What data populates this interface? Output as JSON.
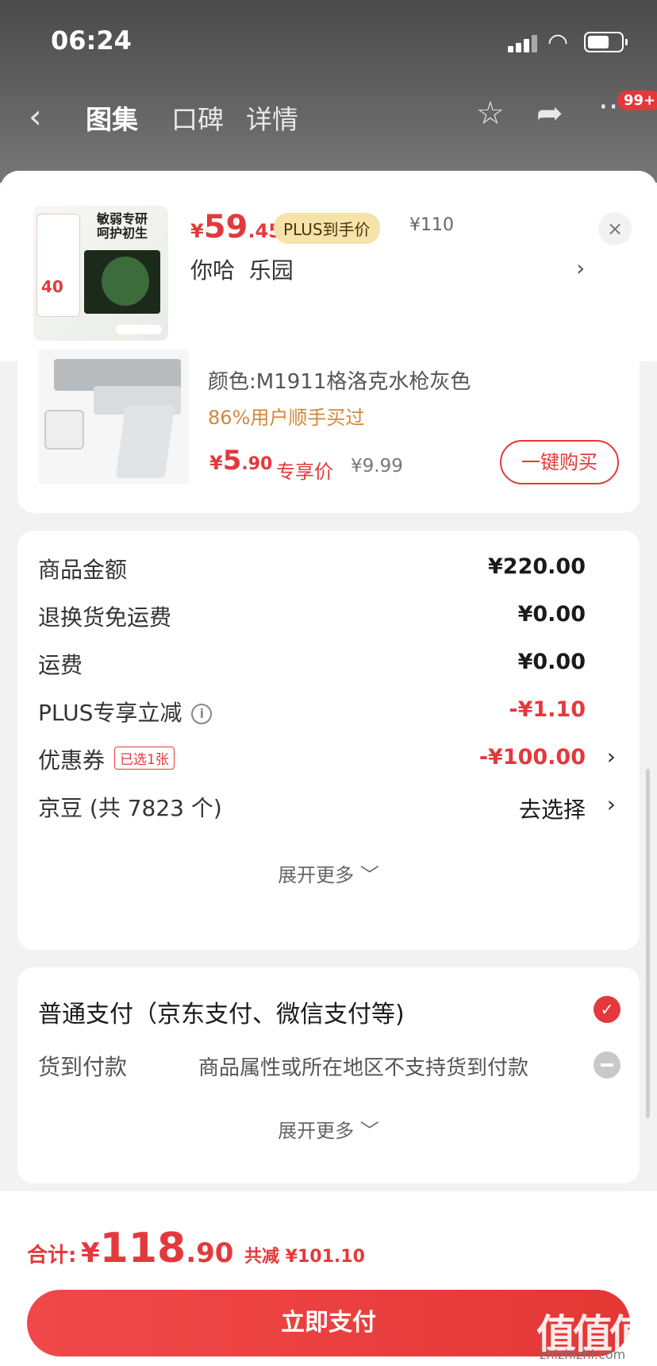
{
  "status_bar": {
    "time": "06:24"
  },
  "header": {
    "tabs": [
      "图集",
      "口碑",
      "详情"
    ],
    "badge": "99+"
  },
  "popup": {
    "image_text": "敏弱专研\n呵护初生",
    "image_tag": "40",
    "price_currency": "¥",
    "price_int": "59",
    "price_dec": ".45",
    "plus_tag": "PLUS到手价",
    "original_price": "¥110",
    "close": "×",
    "product_name": "你哈  乐园",
    "arrow": "›"
  },
  "recommend": {
    "color": "颜色:M1911格洛克水枪灰色",
    "buyers": "86%用户顺手买过",
    "price_currency": "¥",
    "price_int": "5",
    "price_dec": ".90",
    "exclusive": "专享价",
    "old_price": "¥9.99",
    "buy_button": "一键购买"
  },
  "summary": {
    "rows": [
      {
        "label": "商品金额",
        "value": "¥220.00"
      },
      {
        "label": "退换货免运费",
        "value": "¥0.00"
      },
      {
        "label": "运费",
        "value": "¥0.00"
      },
      {
        "label": "PLUS专享立减",
        "value": "-¥1.10",
        "info": "i"
      },
      {
        "label": "优惠券",
        "value": "-¥100.00",
        "tag": "已选1张",
        "arrow": "›"
      },
      {
        "label": "京豆 (共 7823 个)",
        "value": "去选择",
        "arrow": "›"
      }
    ],
    "expand": "展开更多 ﹀"
  },
  "payment": {
    "normal": "普通支付（京东支付、微信支付等)",
    "check": "✓",
    "cod_label": "货到付款",
    "cod_note": "商品属性或所在地区不支持货到付款",
    "expand": "展开更多 ﹀"
  },
  "footer": {
    "total_label": "合计:",
    "currency": "¥",
    "total_int": "118",
    "total_dec": ".90",
    "save": "共减 ¥101.10",
    "pay_button": "立即支付",
    "watermark": "值值值",
    "watermark_sub": "zhizhizhi.com"
  },
  "colors": {
    "accent": "#e4393c",
    "plus": "#f6e3a9",
    "buyers": "#d2873a"
  }
}
